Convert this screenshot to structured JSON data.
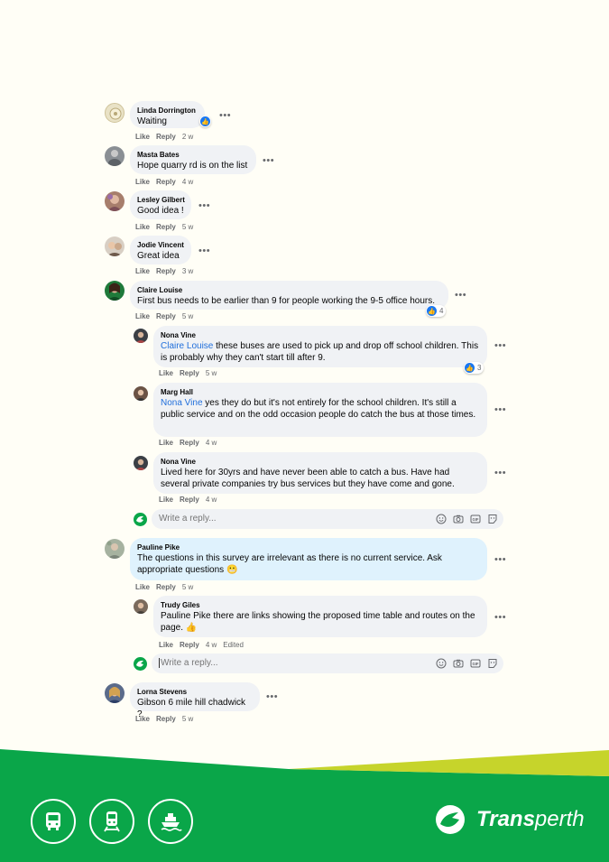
{
  "comments": [
    {
      "name": "Linda Dorrington",
      "text": "Waiting",
      "actions": {
        "like": "Like",
        "reply": "Reply",
        "time": "2 w"
      }
    },
    {
      "name": "Masta Bates",
      "text": "Hope quarry rd is on the list",
      "actions": {
        "like": "Like",
        "reply": "Reply",
        "time": "4 w"
      }
    },
    {
      "name": "Lesley Gilbert",
      "text": "Good idea !",
      "actions": {
        "like": "Like",
        "reply": "Reply",
        "time": "5 w"
      }
    },
    {
      "name": "Jodie Vincent",
      "text": "Great idea",
      "actions": {
        "like": "Like",
        "reply": "Reply",
        "time": "3 w"
      }
    },
    {
      "name": "Claire Louise",
      "text": "First bus needs to be earlier than 9 for people working the 9-5 office hours.",
      "reaction_count": "4",
      "actions": {
        "like": "Like",
        "reply": "Reply",
        "time": "5 w"
      }
    },
    {
      "name": "Pauline Pike",
      "text": "The questions in this survey are irrelevant as there is no current service. Ask appropriate questions 😬",
      "actions": {
        "like": "Like",
        "reply": "Reply",
        "time": "5 w"
      }
    },
    {
      "name": "Lorna Stevens",
      "text": "Gibson 6 mile hill chadwick ?",
      "actions": {
        "like": "Like",
        "reply": "Reply",
        "time": "5 w"
      }
    }
  ],
  "replies_claire": [
    {
      "name": "Nona Vine",
      "mention": "Claire Louise",
      "text": " these buses are used to pick up and drop off school children. This is probably why they can't start till after 9.",
      "reaction_count": "3",
      "actions": {
        "like": "Like",
        "reply": "Reply",
        "time": "5 w"
      }
    },
    {
      "name": "Marg Hall",
      "mention": "Nona Vine",
      "text": " yes they do but it's not entirely for the school children. It's still a public service and on the odd occasion people do catch the bus at those times.",
      "actions": {
        "like": "Like",
        "reply": "Reply",
        "time": "4 w"
      }
    },
    {
      "name": "Nona Vine",
      "text": "Lived here for 30yrs and have never been able to catch a bus. Have had several private companies try bus services but they have come and gone.",
      "actions": {
        "like": "Like",
        "reply": "Reply",
        "time": "4 w"
      }
    }
  ],
  "reply_pauline": {
    "name": "Trudy Giles",
    "text": "Pauline Pike there are links showing the proposed time table and routes on the page. 👍",
    "actions": {
      "like": "Like",
      "reply": "Reply",
      "time": "4 w",
      "edited": "Edited"
    }
  },
  "reply_box": {
    "placeholder": "Write a reply..."
  },
  "footer": {
    "brand_bold": "Trans",
    "brand_light": "perth",
    "icons": [
      "bus-icon",
      "train-icon",
      "ferry-icon"
    ],
    "colors": {
      "green": "#0aa649",
      "lime": "#c6d42b",
      "background": "#fffef6"
    }
  }
}
